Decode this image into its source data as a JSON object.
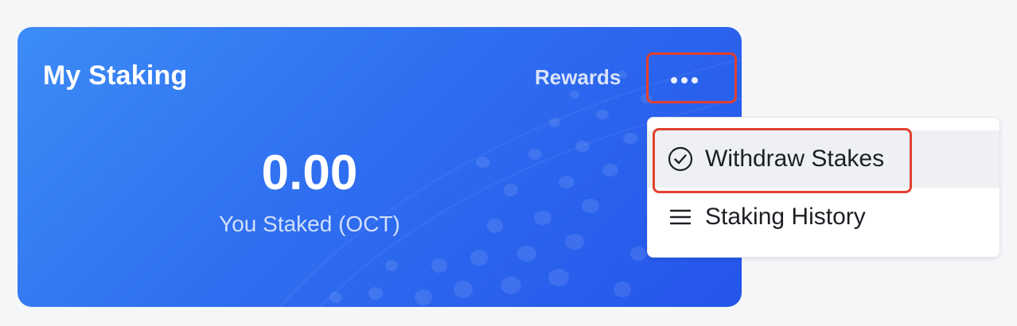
{
  "card": {
    "title": "My Staking",
    "rewards_label": "Rewards",
    "more_icon": "ellipsis-icon",
    "staked_value": "0.00",
    "staked_caption": "You Staked (OCT)"
  },
  "menu": {
    "items": [
      {
        "label": "Withdraw Stakes",
        "icon": "check-circle-icon"
      },
      {
        "label": "Staking History",
        "icon": "list-icon"
      }
    ]
  },
  "colors": {
    "card_gradient_start": "#3d8cf6",
    "card_gradient_end": "#2455ea",
    "highlight_border": "#e2402e"
  }
}
